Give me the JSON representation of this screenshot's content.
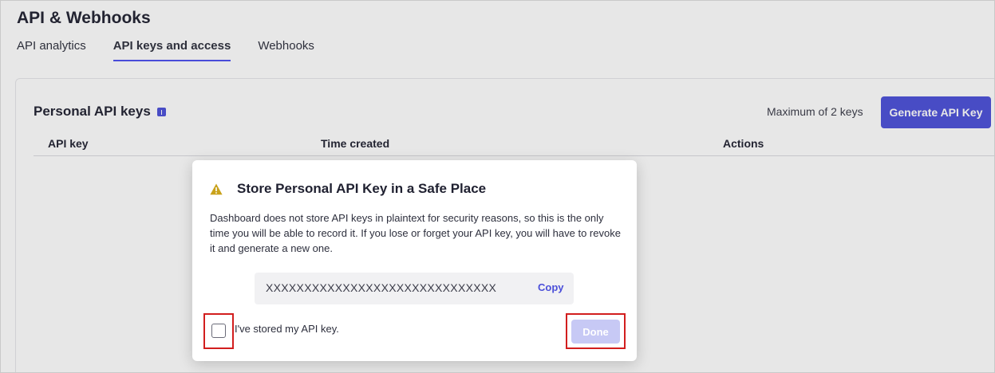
{
  "page": {
    "title": "API & Webhooks",
    "tabs": [
      {
        "label": "API analytics",
        "active": false
      },
      {
        "label": "API keys and access",
        "active": true
      },
      {
        "label": "Webhooks",
        "active": false
      }
    ]
  },
  "panel": {
    "title": "Personal API keys",
    "max_keys_text": "Maximum of 2 keys",
    "generate_button_label": "Generate API Key",
    "columns": [
      "API key",
      "Time created",
      "Actions"
    ]
  },
  "modal": {
    "title": "Store Personal API Key in a Safe Place",
    "body": "Dashboard does not store API keys in plaintext for security reasons, so this is the only time you will be able to record it. If you lose or forget your API key, you will have to revoke it and generate a new one.",
    "key_value": "XXXXXXXXXXXXXXXXXXXXXXXXXXXXXX",
    "copy_label": "Copy",
    "checkbox_label": "I've stored my API key.",
    "checkbox_checked": false,
    "done_label": "Done"
  },
  "colors": {
    "accent": "#4b4fd9",
    "done_disabled": "#c7c9f5",
    "highlight_box": "#d21e1e",
    "warning_icon": "#c9a21b"
  },
  "icons": {
    "info": "info-icon",
    "warning": "warning-icon"
  }
}
